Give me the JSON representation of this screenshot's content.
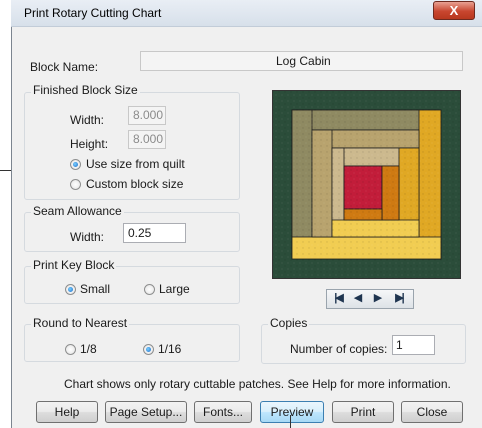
{
  "dialog": {
    "title": "Print Rotary Cutting Chart",
    "close_glyph": "X"
  },
  "block_name": {
    "label": "Block Name:",
    "value": "Log Cabin"
  },
  "finished_block_size": {
    "title": "Finished Block Size",
    "width_label": "Width:",
    "width_value": "8.000",
    "height_label": "Height:",
    "height_value": "8.000",
    "options": [
      "Use size from quilt",
      "Custom block size"
    ],
    "selected_index": 0
  },
  "seam_allowance": {
    "title": "Seam Allowance",
    "width_label": "Width:",
    "width_value": "0.25"
  },
  "print_key_block": {
    "title": "Print Key Block",
    "options": [
      "Small",
      "Large"
    ],
    "selected_index": 0
  },
  "round_to_nearest": {
    "title": "Round to Nearest",
    "options": [
      "1/8",
      "1/16"
    ],
    "selected_index": 1
  },
  "copies": {
    "title": "Copies",
    "label": "Number of copies:",
    "value": "1"
  },
  "navigation": {
    "icons": [
      "first-page-icon",
      "previous-page-icon",
      "next-page-icon",
      "last-page-icon"
    ]
  },
  "info_text": "Chart shows only rotary cuttable patches. See Help for more information.",
  "buttons": {
    "help": "Help",
    "page_setup": "Page Setup...",
    "fonts": "Fonts...",
    "preview": "Preview",
    "print": "Print",
    "close": "Close"
  },
  "colors": {
    "dark_green": "#2b4d3a",
    "olive": "#8f8a62",
    "khaki": "#b8a36e",
    "light_khaki": "#ccb98e",
    "gold": "#e0a824",
    "yellow": "#f1cd52",
    "orange": "#cf7a12",
    "red": "#c21d3a"
  }
}
